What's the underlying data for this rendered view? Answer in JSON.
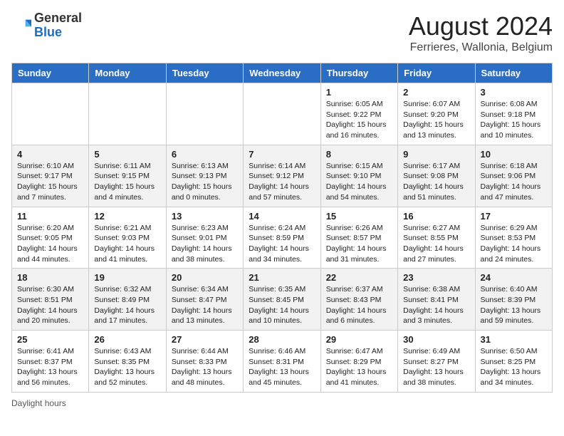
{
  "header": {
    "logo_general": "General",
    "logo_blue": "Blue",
    "month_year": "August 2024",
    "location": "Ferrieres, Wallonia, Belgium"
  },
  "days_of_week": [
    "Sunday",
    "Monday",
    "Tuesday",
    "Wednesday",
    "Thursday",
    "Friday",
    "Saturday"
  ],
  "footer": {
    "daylight_label": "Daylight hours"
  },
  "weeks": [
    [
      {
        "day": "",
        "info": ""
      },
      {
        "day": "",
        "info": ""
      },
      {
        "day": "",
        "info": ""
      },
      {
        "day": "",
        "info": ""
      },
      {
        "day": "1",
        "info": "Sunrise: 6:05 AM\nSunset: 9:22 PM\nDaylight: 15 hours and 16 minutes."
      },
      {
        "day": "2",
        "info": "Sunrise: 6:07 AM\nSunset: 9:20 PM\nDaylight: 15 hours and 13 minutes."
      },
      {
        "day": "3",
        "info": "Sunrise: 6:08 AM\nSunset: 9:18 PM\nDaylight: 15 hours and 10 minutes."
      }
    ],
    [
      {
        "day": "4",
        "info": "Sunrise: 6:10 AM\nSunset: 9:17 PM\nDaylight: 15 hours and 7 minutes."
      },
      {
        "day": "5",
        "info": "Sunrise: 6:11 AM\nSunset: 9:15 PM\nDaylight: 15 hours and 4 minutes."
      },
      {
        "day": "6",
        "info": "Sunrise: 6:13 AM\nSunset: 9:13 PM\nDaylight: 15 hours and 0 minutes."
      },
      {
        "day": "7",
        "info": "Sunrise: 6:14 AM\nSunset: 9:12 PM\nDaylight: 14 hours and 57 minutes."
      },
      {
        "day": "8",
        "info": "Sunrise: 6:15 AM\nSunset: 9:10 PM\nDaylight: 14 hours and 54 minutes."
      },
      {
        "day": "9",
        "info": "Sunrise: 6:17 AM\nSunset: 9:08 PM\nDaylight: 14 hours and 51 minutes."
      },
      {
        "day": "10",
        "info": "Sunrise: 6:18 AM\nSunset: 9:06 PM\nDaylight: 14 hours and 47 minutes."
      }
    ],
    [
      {
        "day": "11",
        "info": "Sunrise: 6:20 AM\nSunset: 9:05 PM\nDaylight: 14 hours and 44 minutes."
      },
      {
        "day": "12",
        "info": "Sunrise: 6:21 AM\nSunset: 9:03 PM\nDaylight: 14 hours and 41 minutes."
      },
      {
        "day": "13",
        "info": "Sunrise: 6:23 AM\nSunset: 9:01 PM\nDaylight: 14 hours and 38 minutes."
      },
      {
        "day": "14",
        "info": "Sunrise: 6:24 AM\nSunset: 8:59 PM\nDaylight: 14 hours and 34 minutes."
      },
      {
        "day": "15",
        "info": "Sunrise: 6:26 AM\nSunset: 8:57 PM\nDaylight: 14 hours and 31 minutes."
      },
      {
        "day": "16",
        "info": "Sunrise: 6:27 AM\nSunset: 8:55 PM\nDaylight: 14 hours and 27 minutes."
      },
      {
        "day": "17",
        "info": "Sunrise: 6:29 AM\nSunset: 8:53 PM\nDaylight: 14 hours and 24 minutes."
      }
    ],
    [
      {
        "day": "18",
        "info": "Sunrise: 6:30 AM\nSunset: 8:51 PM\nDaylight: 14 hours and 20 minutes."
      },
      {
        "day": "19",
        "info": "Sunrise: 6:32 AM\nSunset: 8:49 PM\nDaylight: 14 hours and 17 minutes."
      },
      {
        "day": "20",
        "info": "Sunrise: 6:34 AM\nSunset: 8:47 PM\nDaylight: 14 hours and 13 minutes."
      },
      {
        "day": "21",
        "info": "Sunrise: 6:35 AM\nSunset: 8:45 PM\nDaylight: 14 hours and 10 minutes."
      },
      {
        "day": "22",
        "info": "Sunrise: 6:37 AM\nSunset: 8:43 PM\nDaylight: 14 hours and 6 minutes."
      },
      {
        "day": "23",
        "info": "Sunrise: 6:38 AM\nSunset: 8:41 PM\nDaylight: 14 hours and 3 minutes."
      },
      {
        "day": "24",
        "info": "Sunrise: 6:40 AM\nSunset: 8:39 PM\nDaylight: 13 hours and 59 minutes."
      }
    ],
    [
      {
        "day": "25",
        "info": "Sunrise: 6:41 AM\nSunset: 8:37 PM\nDaylight: 13 hours and 56 minutes."
      },
      {
        "day": "26",
        "info": "Sunrise: 6:43 AM\nSunset: 8:35 PM\nDaylight: 13 hours and 52 minutes."
      },
      {
        "day": "27",
        "info": "Sunrise: 6:44 AM\nSunset: 8:33 PM\nDaylight: 13 hours and 48 minutes."
      },
      {
        "day": "28",
        "info": "Sunrise: 6:46 AM\nSunset: 8:31 PM\nDaylight: 13 hours and 45 minutes."
      },
      {
        "day": "29",
        "info": "Sunrise: 6:47 AM\nSunset: 8:29 PM\nDaylight: 13 hours and 41 minutes."
      },
      {
        "day": "30",
        "info": "Sunrise: 6:49 AM\nSunset: 8:27 PM\nDaylight: 13 hours and 38 minutes."
      },
      {
        "day": "31",
        "info": "Sunrise: 6:50 AM\nSunset: 8:25 PM\nDaylight: 13 hours and 34 minutes."
      }
    ]
  ]
}
